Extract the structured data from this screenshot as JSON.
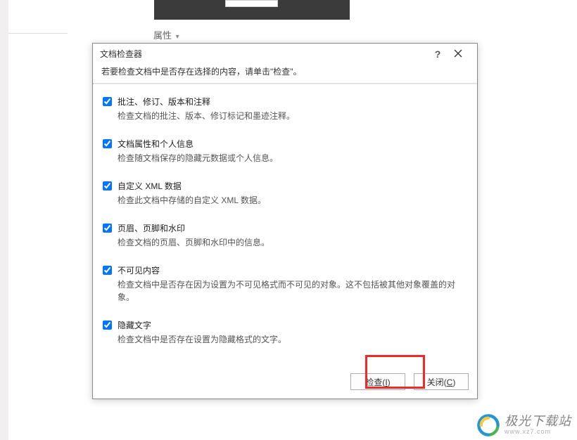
{
  "background": {
    "properties_label": "属性",
    "dropdown_glyph": "▾"
  },
  "dialog": {
    "title": "文档检查器",
    "help_glyph": "?",
    "instruction": "若要检查文档中是否存在选择的内容，请单击\"检查\"。",
    "items": [
      {
        "title": "批注、修订、版本和注释",
        "desc": "检查文档的批注、版本、修订标记和墨迹注释。"
      },
      {
        "title": "文档属性和个人信息",
        "desc": "检查随文档保存的隐藏元数据或个人信息。"
      },
      {
        "title": "自定义 XML 数据",
        "desc": "检查此文档中存储的自定义 XML 数据。"
      },
      {
        "title": "页眉、页脚和水印",
        "desc": "检查文档的页眉、页脚和水印中的信息。"
      },
      {
        "title": "不可见内容",
        "desc": "检查文档中是否存在因为设置为不可见格式而不可见的对象。这不包括被其他对象覆盖的对象。"
      },
      {
        "title": "隐藏文字",
        "desc": "检查文档中是否存在设置为隐藏格式的文字。"
      }
    ],
    "buttons": {
      "inspect_label": "检查(",
      "inspect_key": "I",
      "inspect_tail": ")",
      "close_label": "关闭(",
      "close_key": "C",
      "close_tail": ")"
    }
  },
  "watermark": {
    "text": "极光下载站",
    "sub": "www.xz7.com"
  }
}
